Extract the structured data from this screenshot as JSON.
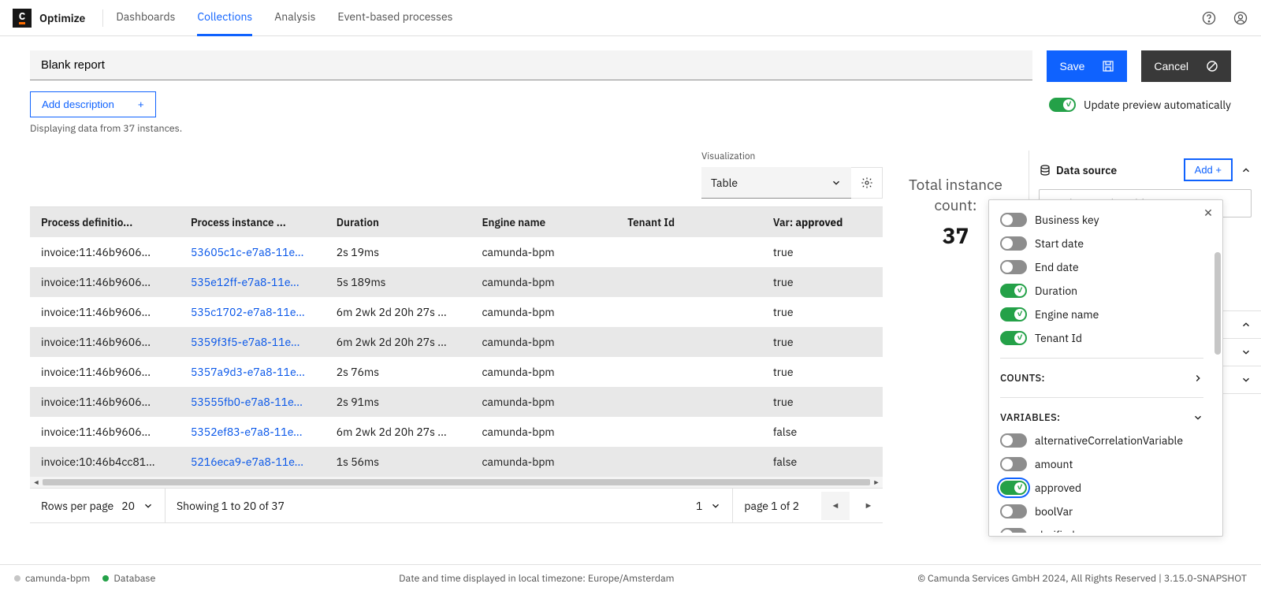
{
  "brand": "Optimize",
  "nav": [
    "Dashboards",
    "Collections",
    "Analysis",
    "Event-based processes"
  ],
  "nav_active": 1,
  "report_title": "Blank report",
  "save": "Save",
  "cancel": "Cancel",
  "add_description": "Add description",
  "instances_hint": "Displaying data from 37 instances.",
  "preview_label": "Update preview automatically",
  "viz": {
    "label": "Visualization",
    "value": "Table"
  },
  "summary": {
    "label": "Total instance count:",
    "value": "37"
  },
  "table": {
    "cols": [
      "Process definitio...",
      "Process instance ...",
      "Duration",
      "Engine name",
      "Tenant Id"
    ],
    "var_col_prefix": "Var: ",
    "var_col": "approved",
    "rows": [
      {
        "pd": "invoice:11:46b9606...",
        "pi": "53605c1c-e7a8-11e...",
        "dur": "2s 19ms",
        "en": "camunda-bpm",
        "tn": "",
        "var": "true"
      },
      {
        "pd": "invoice:11:46b9606...",
        "pi": "535e12ff-e7a8-11e...",
        "dur": "5s 189ms",
        "en": "camunda-bpm",
        "tn": "",
        "var": "true"
      },
      {
        "pd": "invoice:11:46b9606...",
        "pi": "535c1702-e7a8-11e...",
        "dur": "6m 2wk 2d 20h 27s ...",
        "en": "camunda-bpm",
        "tn": "",
        "var": "true"
      },
      {
        "pd": "invoice:11:46b9606...",
        "pi": "5359f3f5-e7a8-11e...",
        "dur": "6m 2wk 2d 20h 27s ...",
        "en": "camunda-bpm",
        "tn": "",
        "var": "true"
      },
      {
        "pd": "invoice:11:46b9606...",
        "pi": "5357a9d3-e7a8-11e...",
        "dur": "2s 76ms",
        "en": "camunda-bpm",
        "tn": "",
        "var": "true"
      },
      {
        "pd": "invoice:11:46b9606...",
        "pi": "53555fb0-e7a8-11e...",
        "dur": "2s 91ms",
        "en": "camunda-bpm",
        "tn": "",
        "var": "true"
      },
      {
        "pd": "invoice:11:46b9606...",
        "pi": "5352ef83-e7a8-11e...",
        "dur": "6m 2wk 2d 20h 27s ...",
        "en": "camunda-bpm",
        "tn": "",
        "var": "false"
      },
      {
        "pd": "invoice:10:46b4cc81...",
        "pi": "5216eca9-e7a8-11e...",
        "dur": "1s 56ms",
        "en": "camunda-bpm",
        "tn": "",
        "var": "false"
      }
    ]
  },
  "pager": {
    "rpp_label": "Rows per page",
    "rpp": "20",
    "showing": "Showing 1 to 20 of 37",
    "page": "1",
    "page_of": "page 1 of 2"
  },
  "right": {
    "data_source": "Data source",
    "add": "Add +",
    "ds_value": "Invoice Receipt with"
  },
  "popover": {
    "fields": [
      {
        "label": "Business key",
        "on": false
      },
      {
        "label": "Start date",
        "on": false
      },
      {
        "label": "End date",
        "on": false
      },
      {
        "label": "Duration",
        "on": true
      },
      {
        "label": "Engine name",
        "on": true
      },
      {
        "label": "Tenant Id",
        "on": true
      }
    ],
    "counts": "COUNTS:",
    "variables": "VARIABLES:",
    "vars": [
      {
        "label": "alternativeCorrelationVariable",
        "on": false
      },
      {
        "label": "amount",
        "on": false
      },
      {
        "label": "approved",
        "on": true,
        "focus": true
      },
      {
        "label": "boolVar",
        "on": false
      },
      {
        "label": "clarified",
        "on": false
      }
    ]
  },
  "footer": {
    "engine": "camunda-bpm",
    "db": "Database",
    "tz": "Date and time displayed in local timezone: Europe/Amsterdam",
    "legal": "© Camunda Services GmbH 2024, All Rights Reserved | 3.15.0-SNAPSHOT"
  }
}
